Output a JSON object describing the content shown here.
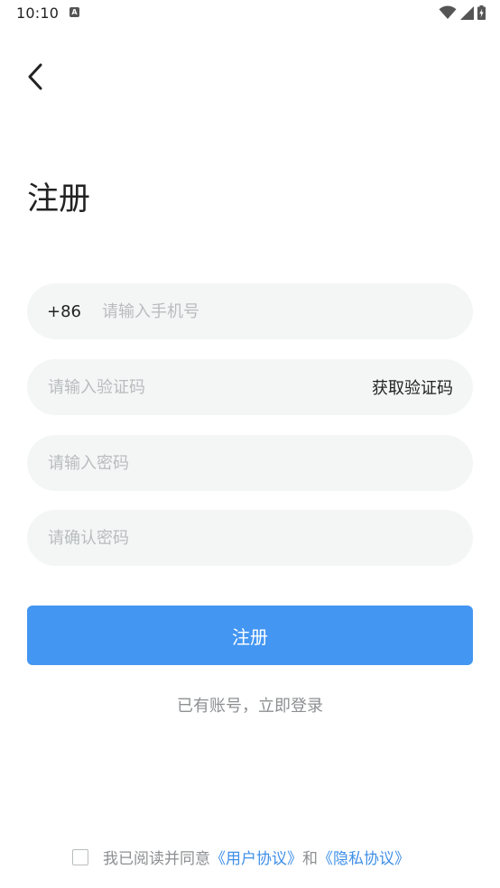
{
  "status_bar": {
    "time": "10:10",
    "notification_glyph": "A",
    "icons": [
      "wifi-icon",
      "signal-icon",
      "battery-charging-icon"
    ]
  },
  "header": {
    "back_icon": "chevron-left-icon",
    "title": "注册"
  },
  "form": {
    "phone": {
      "country_code": "+86",
      "placeholder": "请输入手机号",
      "value": ""
    },
    "verification_code": {
      "placeholder": "请输入验证码",
      "value": "",
      "get_code_label": "获取验证码"
    },
    "password": {
      "placeholder": "请输入密码",
      "value": ""
    },
    "confirm_password": {
      "placeholder": "请确认密码",
      "value": ""
    },
    "submit_label": "注册"
  },
  "login_link": "已有账号，立即登录",
  "agreement": {
    "checked": false,
    "prefix": "我已阅读并同意",
    "user_agreement": "《用户协议》",
    "conjunction": "和",
    "privacy_policy": "《隐私协议》"
  },
  "colors": {
    "primary": "#4396f2",
    "link": "#3f8fe8",
    "field_background": "#f4f6f6",
    "placeholder": "#b9bcbe",
    "secondary_text": "#8d8f91"
  }
}
